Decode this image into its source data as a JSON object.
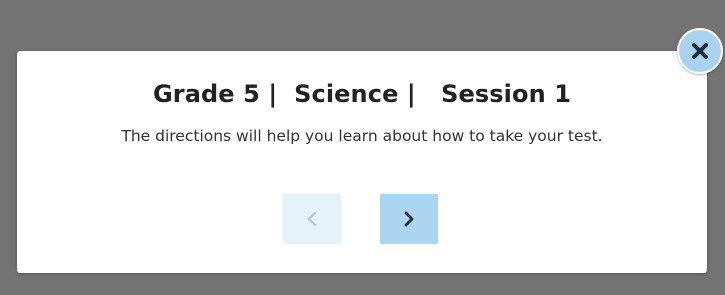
{
  "dialog": {
    "title": "Grade 5 |  Science |   Session 1",
    "description": "The directions will help you learn about how to take your test."
  },
  "navigation": {
    "previous_enabled": false,
    "next_enabled": true
  },
  "icons": {
    "previous": "chevron-left-icon",
    "next": "chevron-right-icon",
    "close": "close-icon"
  },
  "colors": {
    "overlay": "#737373",
    "dialog_background": "#ffffff",
    "next_button": "#acd5f1",
    "previous_button_disabled": "#e6f2fa",
    "close_button": "#a9d2ee",
    "icon_dark": "#1b2e3c"
  }
}
